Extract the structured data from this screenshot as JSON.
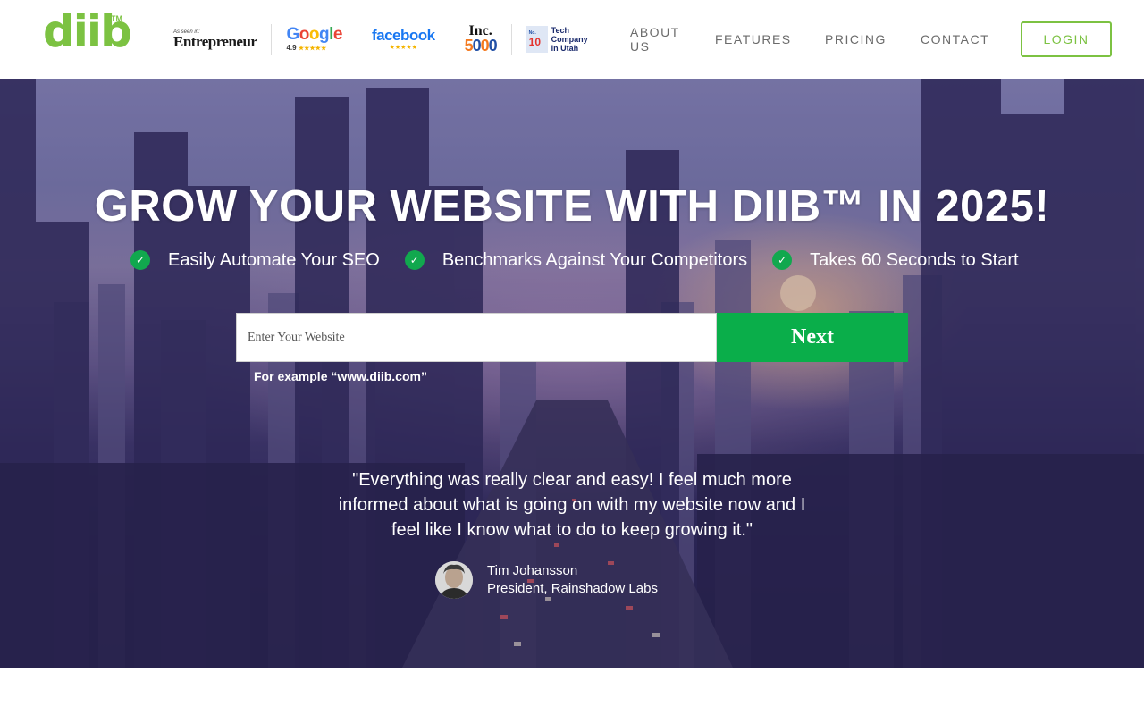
{
  "header": {
    "logo": {
      "text": "diib",
      "tm": "TM"
    },
    "badges": {
      "entrepreneur": {
        "small": "As seen in:",
        "name": "Entrepreneur"
      },
      "google": {
        "rating": "4.9"
      },
      "facebook": {
        "name": "facebook"
      },
      "inc": {
        "top": "Inc.",
        "bottom": "5000"
      },
      "tech": {
        "no": "No.",
        "rank": "10",
        "line1": "Tech",
        "line2": "Company",
        "line3": "in Utah"
      }
    },
    "nav": {
      "about": "ABOUT US",
      "features": "FEATURES",
      "pricing": "PRICING",
      "contact": "CONTACT"
    },
    "login_label": "LOGIN"
  },
  "hero": {
    "title": "GROW YOUR WEBSITE WITH DIIB™ IN 2025!",
    "features": [
      "Easily Automate Your SEO",
      "Benchmarks Against Your Competitors",
      "Takes 60 Seconds to Start"
    ],
    "input_placeholder": "Enter Your Website",
    "next_label": "Next",
    "example_text": "For example “www.diib.com”",
    "testimonial": {
      "quote": "\"Everything was really clear and easy! I feel much more informed about what is going on with my website now and I feel like I know what to do to keep growing it.\"",
      "name": "Tim Johansson",
      "role": "President, Rainshadow Labs"
    }
  },
  "colors": {
    "brand_green": "#7cc242",
    "cta_green": "#0aae4a",
    "check_green": "#11a84e",
    "nav_gray": "#6b6b6b"
  },
  "icons": [
    "check-icon",
    "star-icon"
  ]
}
